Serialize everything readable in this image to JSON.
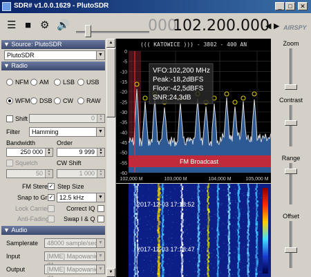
{
  "window": {
    "title": "SDR# v1.0.0.1629 - PlutoSDR"
  },
  "toolbar": {
    "frequency_dim": "000.",
    "frequency_main": "102.200.000",
    "arrow_left": "◀",
    "arrow_right": "▶",
    "brand": "AIRSPY"
  },
  "source": {
    "header": "Source: PlutoSDR",
    "device": "PlutoSDR"
  },
  "radio": {
    "header": "Radio",
    "modes_row1": [
      "NFM",
      "AM",
      "LSB",
      "USB"
    ],
    "modes_row2": [
      "WFM",
      "DSB",
      "CW",
      "RAW"
    ],
    "selected_mode": "WFM",
    "shift_label": "Shift",
    "shift_value": "0",
    "filter_label": "Filter",
    "filter_value": "Hamming",
    "bandwidth_label": "Bandwidth",
    "bandwidth_value": "250 000",
    "order_label": "Order",
    "order_value": "9 999",
    "squelch_label": "Squelch",
    "squelch_value": "50",
    "cw_shift_label": "CW Shift",
    "cw_shift_value": "1 000",
    "fm_stereo_label": "FM Stereo",
    "fm_stereo_checked": true,
    "step_size_label": "Step Size",
    "snap_to_grid_label": "Snap to Grid",
    "snap_to_grid_checked": true,
    "step_size_value": "12.5 kHz",
    "lock_carrier_label": "Lock Carrier",
    "correct_iq_label": "Correct IQ",
    "anti_fading_label": "Anti-Fading",
    "swap_iq_label": "Swap I & Q"
  },
  "audio": {
    "header": "Audio",
    "samplerate_label": "Samplerate",
    "samplerate_value": "48000 sample/sec",
    "input_label": "Input",
    "input_value": "[MME] Mapowanie dź",
    "output_label": "Output",
    "output_value": "[MME] Mapowanie dź"
  },
  "spectrum": {
    "station": "((( KATOWICE ))) - 3802 - 400  AN",
    "vfo": "VFO:102,200 MHz",
    "peak": "Peak:-18,2dBFS",
    "floor": "Floor:-42,5dBFS",
    "snr": "SNR:24,3dB",
    "band_label": "FM Broadcast",
    "y_ticks": [
      "0",
      "-5",
      "-10",
      "-15",
      "-20",
      "-25",
      "-30",
      "-35",
      "-40",
      "-45",
      "-50",
      "-55",
      "-60"
    ],
    "x_ticks": [
      "102,000 M",
      "103,000 M",
      "104,000 M",
      "105,000 M"
    ],
    "colors": {
      "trace": "#d8d8d8",
      "fill": "#2d5a94",
      "band": "#c02a3a",
      "peak_marker": "#e8d400"
    }
  },
  "waterfall": {
    "timestamp_1": "2017-12-03 17:18:52",
    "timestamp_2": "2017-12-03 17:18:47"
  },
  "right_panel": {
    "zoom_label": "Zoom",
    "contrast_label": "Contrast",
    "range_label": "Range",
    "offset_label": "Offset"
  }
}
